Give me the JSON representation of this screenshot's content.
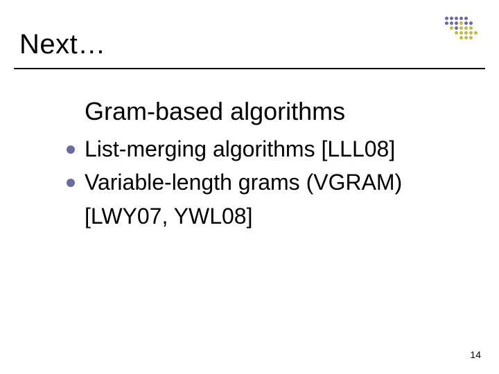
{
  "title": "Next…",
  "subtitle": "Gram-based algorithms",
  "bullets": [
    {
      "text_line1": "List-merging algorithms [LLL08]",
      "text_line2": ""
    },
    {
      "text_line1": "Variable-length grams (VGRAM)",
      "text_line2": "[LWY07, YWL08]"
    }
  ],
  "page_number": "14",
  "logo_colors": {
    "purple": "#6b6c9e",
    "olive": "#c3b84a",
    "empty": "transparent"
  },
  "logo_pattern": [
    [
      "purple",
      "purple",
      "purple",
      "purple",
      "purple",
      "empty",
      "empty"
    ],
    [
      "purple",
      "purple",
      "purple",
      "olive",
      "purple",
      "purple",
      "empty"
    ],
    [
      "empty",
      "olive",
      "purple",
      "olive",
      "olive",
      "olive",
      "empty"
    ],
    [
      "empty",
      "empty",
      "olive",
      "olive",
      "olive",
      "olive",
      "olive"
    ],
    [
      "empty",
      "empty",
      "empty",
      "olive",
      "olive",
      "olive",
      "empty"
    ]
  ]
}
